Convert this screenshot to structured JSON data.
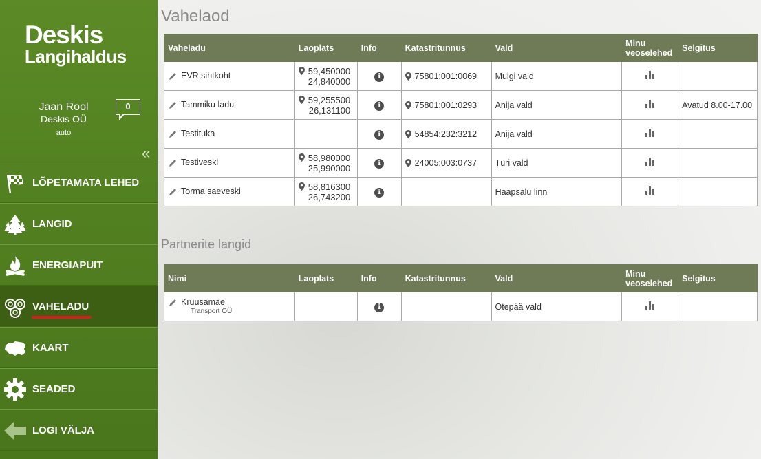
{
  "app": {
    "logo_line1": "Deskis",
    "logo_line2": "Langihaldus"
  },
  "user": {
    "name": "Jaan Rool",
    "company": "Deskis OÜ",
    "role": "auto",
    "messages": "0"
  },
  "nav": [
    {
      "label": "LÕPETAMATA LEHED",
      "icon": "checkered-flag-icon"
    },
    {
      "label": "LANGID",
      "icon": "forest-icon"
    },
    {
      "label": "ENERGIAPUIT",
      "icon": "fire-icon"
    },
    {
      "label": "VAHELADU",
      "icon": "logs-icon",
      "active": true
    },
    {
      "label": "KAART",
      "icon": "map-estonia-icon"
    },
    {
      "label": "SEADED",
      "icon": "gear-icon"
    },
    {
      "label": "LOGI VÄLJA",
      "icon": "arrow-left-icon"
    }
  ],
  "vahelaod": {
    "title": "Vahelaod",
    "headers": {
      "c1": "Vaheladu",
      "c2": "Laoplats",
      "c3": "Info",
      "c4": "Katastritunnus",
      "c5": "Vald",
      "c6a": "Minu",
      "c6b": "veoselehed",
      "c7": "Selgitus"
    },
    "rows": [
      {
        "name": "EVR sihtkoht",
        "lat": "59,450000",
        "lon": "24,840000",
        "kataster": "75801:001:0069",
        "vald": "Mulgi vald",
        "selgitus": ""
      },
      {
        "name": "Tammiku ladu",
        "lat": "59,255500",
        "lon": "26,131100",
        "kataster": "75801:001:0293",
        "vald": "Anija vald",
        "selgitus": "Avatud 8.00-17.00"
      },
      {
        "name": "Testituka",
        "lat": "",
        "lon": "",
        "kataster": "54854:232:3212",
        "vald": "Anija vald",
        "selgitus": ""
      },
      {
        "name": "Testiveski",
        "lat": "58,980000",
        "lon": "25,990000",
        "kataster": "24005:003:0737",
        "vald": "Türi vald",
        "selgitus": ""
      },
      {
        "name": "Torma saeveski",
        "lat": "58,816300",
        "lon": "26,743200",
        "kataster": "",
        "vald": "Haapsalu linn",
        "selgitus": ""
      }
    ]
  },
  "partnerid": {
    "title": "Partnerite langid",
    "headers": {
      "c1": "Nimi",
      "c2": "Laoplats",
      "c3": "Info",
      "c4": "Katastritunnus",
      "c5": "Vald",
      "c6a": "Minu",
      "c6b": "veoselehed",
      "c7": "Selgitus"
    },
    "rows": [
      {
        "name": "Kruusamäe",
        "sub": "Transport OÜ",
        "vald": "Otepää vald"
      }
    ]
  },
  "colors": {
    "sidebar": "#558522",
    "header": "#6e7b56",
    "active_underline": "#d71f1f"
  }
}
